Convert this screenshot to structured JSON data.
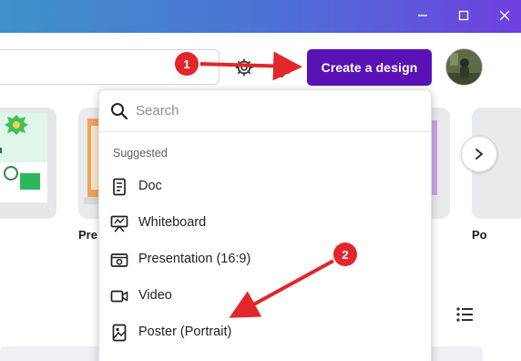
{
  "window": {
    "controls": [
      "minimize",
      "maximize",
      "close"
    ]
  },
  "header": {
    "create_button_label": "Create a design"
  },
  "cards": [
    {
      "label": "Pre"
    },
    {
      "label": "Po"
    }
  ],
  "dropdown": {
    "search_placeholder": "Search",
    "section_title": "Suggested",
    "items": [
      {
        "label": "Doc",
        "icon": "doc-icon"
      },
      {
        "label": "Whiteboard",
        "icon": "whiteboard-icon"
      },
      {
        "label": "Presentation (16:9)",
        "icon": "presentation-icon"
      },
      {
        "label": "Video",
        "icon": "video-icon"
      },
      {
        "label": "Poster (Portrait)",
        "icon": "poster-icon"
      }
    ]
  },
  "annotations": [
    {
      "number": "1"
    },
    {
      "number": "2"
    }
  ],
  "colors": {
    "brand_button": "#5a11b5",
    "annotation_red": "#e2262b"
  }
}
